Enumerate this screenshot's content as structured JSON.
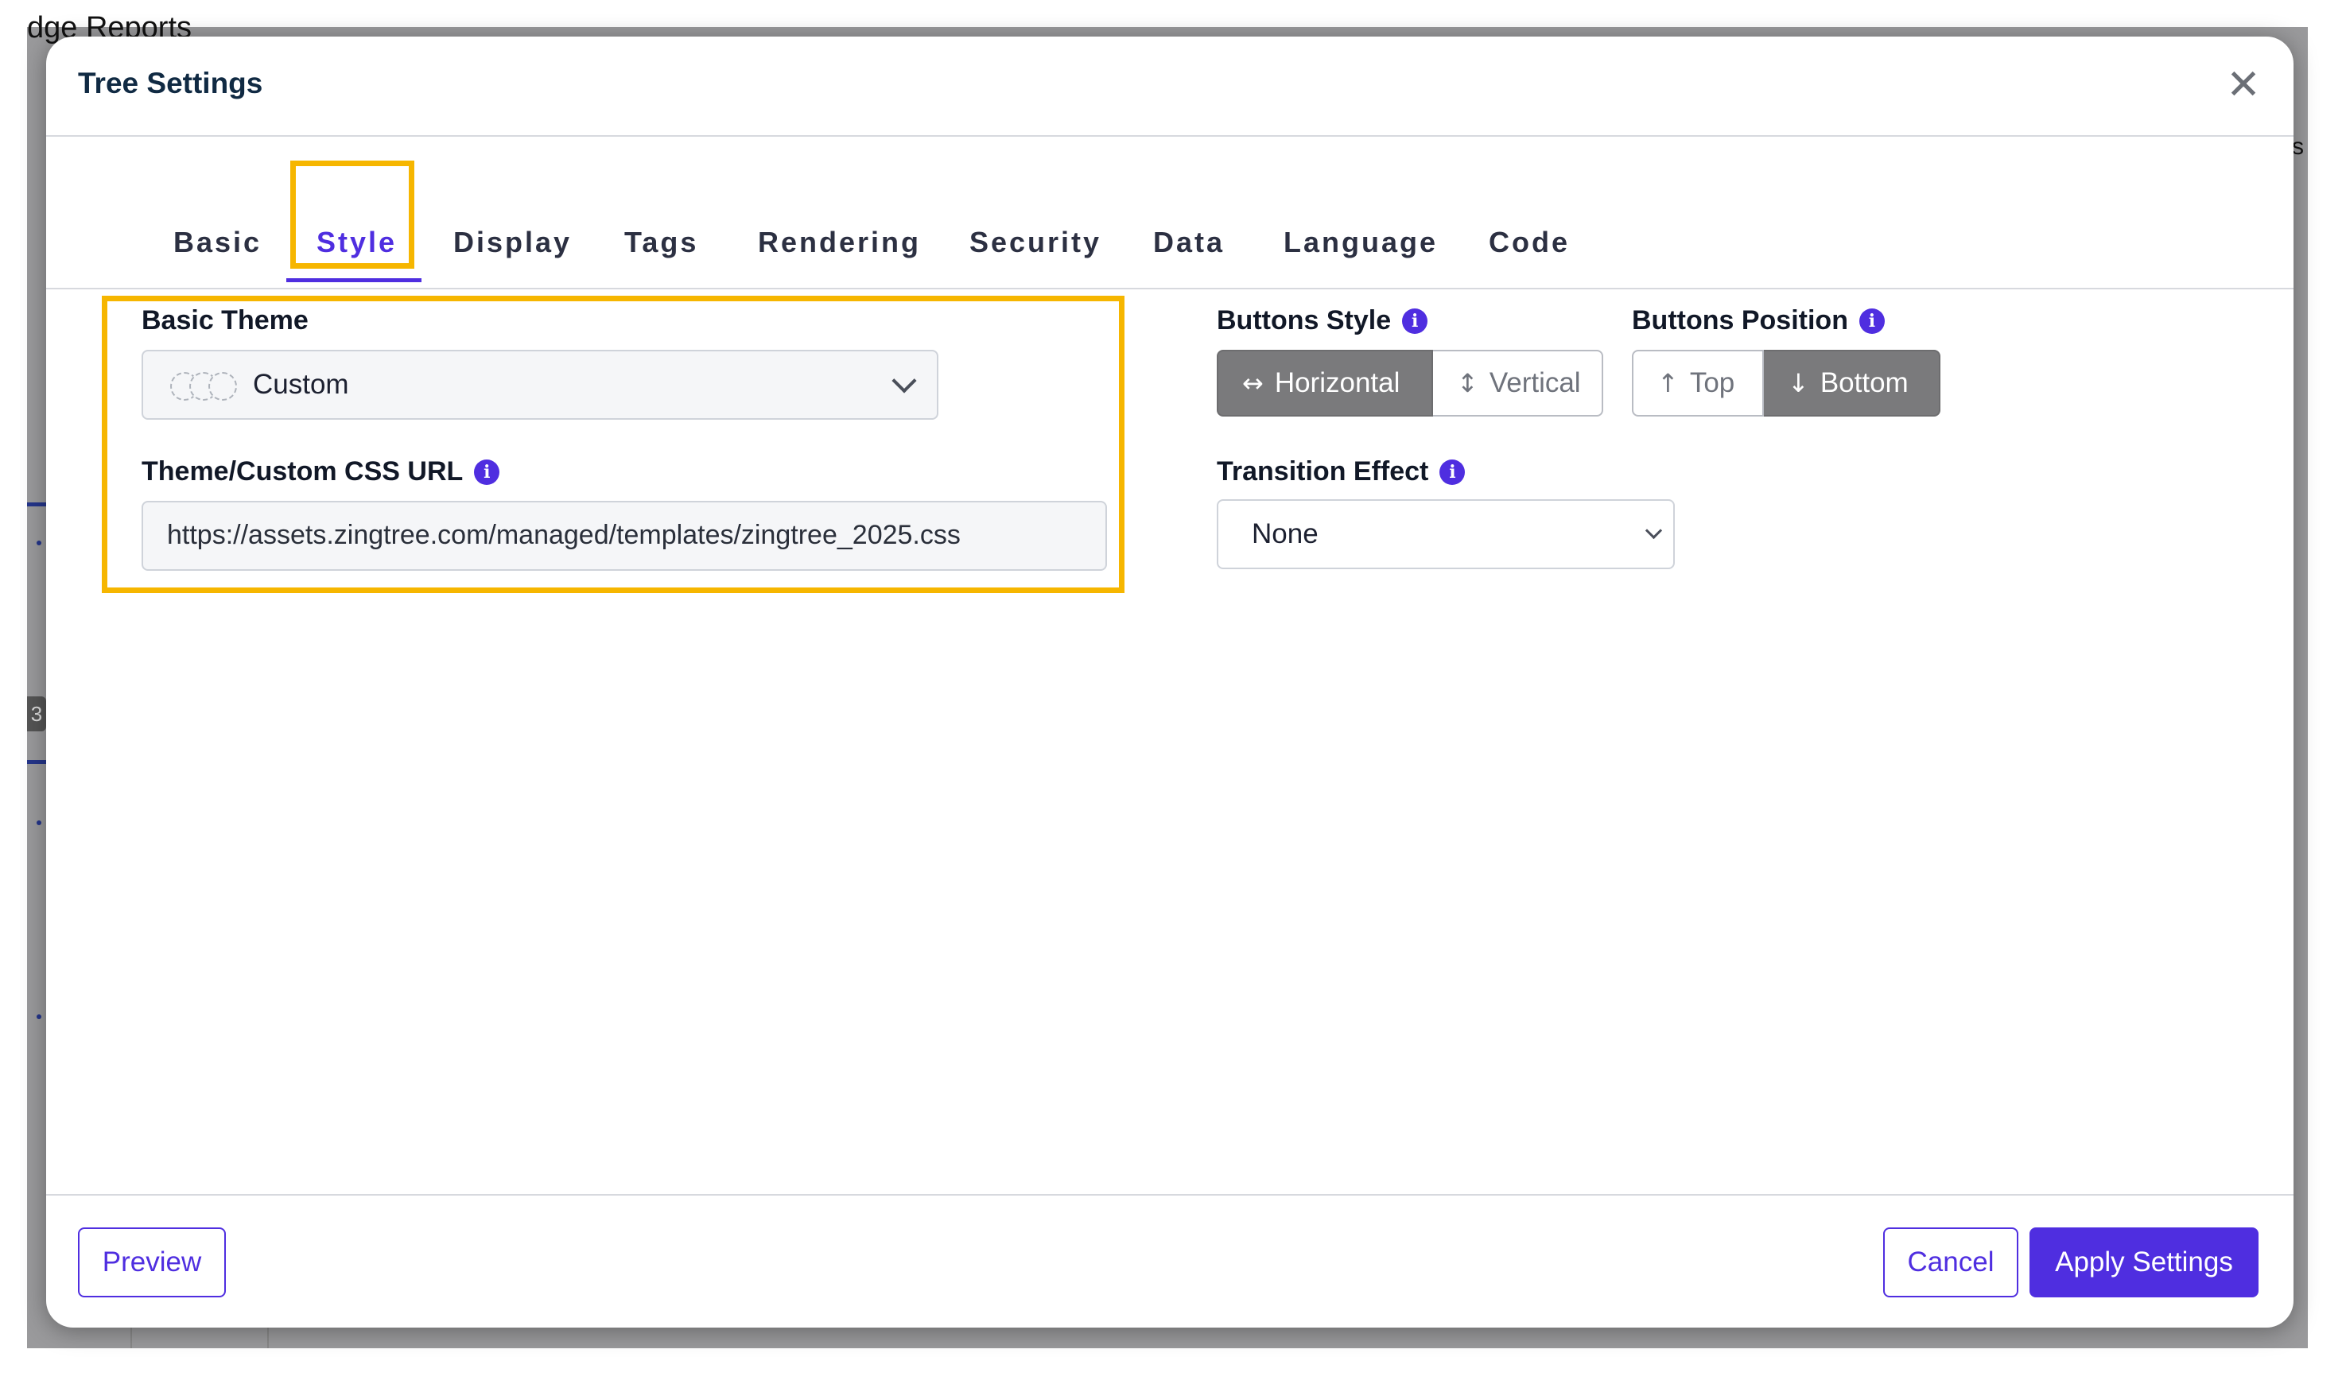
{
  "background": {
    "page_title": "dge Reports",
    "right_edge_text": "s",
    "badge_text": "3"
  },
  "modal": {
    "title": "Tree Settings",
    "close_glyph": "✕"
  },
  "tabs": [
    {
      "label": "Basic",
      "active": false
    },
    {
      "label": "Style",
      "active": true
    },
    {
      "label": "Display",
      "active": false
    },
    {
      "label": "Tags",
      "active": false
    },
    {
      "label": "Rendering",
      "active": false
    },
    {
      "label": "Security",
      "active": false
    },
    {
      "label": "Data",
      "active": false
    },
    {
      "label": "Language",
      "active": false
    },
    {
      "label": "Code",
      "active": false
    }
  ],
  "style_settings": {
    "basic_theme": {
      "label": "Basic Theme",
      "value": "Custom",
      "icon": "chevron-down-icon"
    },
    "css_url": {
      "label": "Theme/Custom CSS URL",
      "info_icon": "i",
      "value": "https://assets.zingtree.com/managed/templates/zingtree_2025.css"
    },
    "buttons_style": {
      "label": "Buttons Style",
      "info_icon": "i",
      "options": [
        {
          "label": "Horizontal",
          "glyph": "↔",
          "selected": true
        },
        {
          "label": "Vertical",
          "glyph": "↕",
          "selected": false
        }
      ]
    },
    "buttons_position": {
      "label": "Buttons Position",
      "info_icon": "i",
      "options": [
        {
          "label": "Top",
          "glyph": "↑",
          "selected": false
        },
        {
          "label": "Bottom",
          "glyph": "↓",
          "selected": true
        }
      ]
    },
    "transition_effect": {
      "label": "Transition Effect",
      "info_icon": "i",
      "value": "None"
    }
  },
  "footer": {
    "preview_label": "Preview",
    "cancel_label": "Cancel",
    "apply_label": "Apply Settings"
  },
  "colors": {
    "accent": "#4f2ee0",
    "highlight": "#f6b600",
    "segment_selected": "#7a7a7c"
  }
}
